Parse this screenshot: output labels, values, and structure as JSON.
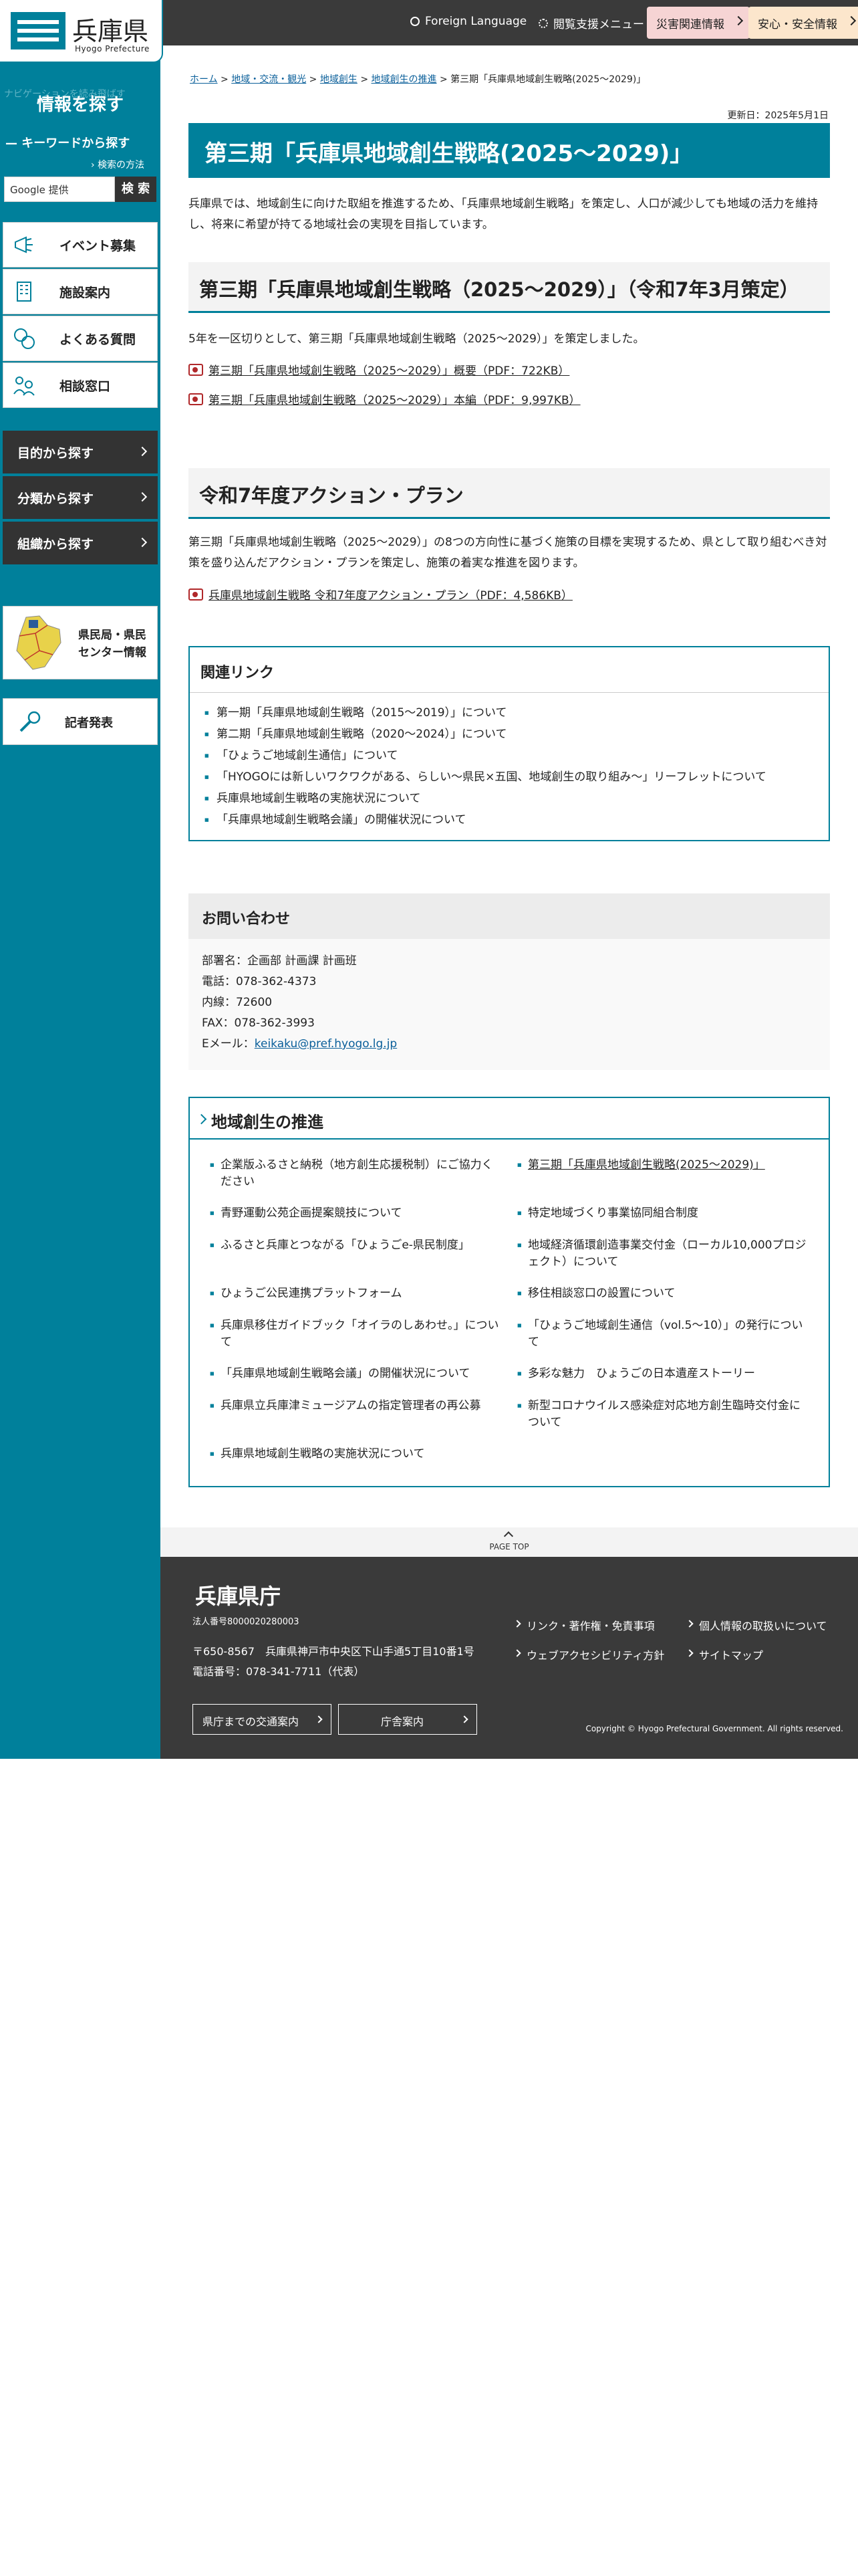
{
  "header": {
    "foreign_language": "Foreign Language",
    "accessibility": "閲覧支援メニュー",
    "disaster": "災害関連情報",
    "safety": "安心・安全情報"
  },
  "logo": {
    "name": "兵庫県",
    "sub": "Hyogo Prefecture"
  },
  "sidebar": {
    "faint_text": "ナビゲーションを読み飛ばす",
    "heading": "情報を探す",
    "keyword": "キーワードから探す",
    "how_to": "検索の方法",
    "search_placeholder": "Google 提供",
    "search_button": "検 索",
    "items": [
      "イベント募集",
      "施設案内",
      "よくある質問",
      "相談窓口"
    ],
    "dark_items": [
      "目的から探す",
      "分類から探す",
      "組織から探す"
    ],
    "center_label_1": "県民局・県民",
    "center_label_2": "センター情報",
    "press": "記者発表"
  },
  "breadcrumb": {
    "home": "ホーム",
    "c1": "地域・交流・観光",
    "c2": "地域創生",
    "c3": "地域創生の推進",
    "current": "第三期「兵庫県地域創生戦略(2025〜2029)」"
  },
  "updated": "更新日：2025年5月1日",
  "title": "第三期「兵庫県地域創生戦略(2025〜2029)」",
  "intro": "兵庫県では、地域創生に向けた取組を推進するため、「兵庫県地域創生戦略」を策定し、人口が減少しても地域の活力を維持し、将来に希望が持てる地域社会の実現を目指しています。",
  "section1": {
    "heading": "第三期「兵庫県地域創生戦略（2025〜2029）」（令和7年3月策定）",
    "text": "5年を一区切りとして、第三期「兵庫県地域創生戦略（2025〜2029）」を策定しました。",
    "pdf1": "第三期「兵庫県地域創生戦略（2025〜2029）」概要（PDF：722KB）",
    "pdf2": "第三期「兵庫県地域創生戦略（2025〜2029）」本編（PDF：9,997KB）"
  },
  "section2": {
    "heading": "令和7年度アクション・プラン",
    "text": "第三期「兵庫県地域創生戦略（2025〜2029）」の8つの方向性に基づく施策の目標を実現するため、県として取り組むべき対策を盛り込んだアクション・プランを策定し、施策の着実な推進を図ります。",
    "pdf": "兵庫県地域創生戦略 令和7年度アクション・プラン（PDF：4,586KB）"
  },
  "related": {
    "heading": "関連リンク",
    "items": [
      "第一期「兵庫県地域創生戦略（2015〜2019）」について",
      "第二期「兵庫県地域創生戦略（2020〜2024）」について",
      "「ひょうご地域創生通信」について",
      "「HYOGOには新しいワクワクがある、らしい〜県民×五国、地域創生の取り組み〜」リーフレットについて",
      "兵庫県地域創生戦略の実施状況について",
      "「兵庫県地域創生戦略会議」の開催状況について"
    ]
  },
  "contact": {
    "heading": "お問い合わせ",
    "dept": "部署名：企画部 計画課 計画班",
    "tel": "電話：078-362-4373",
    "ext": "内線：72600",
    "fax": "FAX：078-362-3993",
    "email_label": "Eメール：",
    "email": "keikaku@pref.hyogo.lg.jp"
  },
  "promo": {
    "heading": "地域創生の推進",
    "left": [
      "企業版ふるさと納税（地方創生応援税制）にご協力ください",
      "青野運動公苑企画提案競技について",
      "ふるさと兵庫とつながる「ひょうごe-県民制度」",
      "ひょうご公民連携プラットフォーム",
      "兵庫県移住ガイドブック「オイラのしあわせ。」について",
      "「兵庫県地域創生戦略会議」の開催状況について",
      "兵庫県立兵庫津ミュージアムの指定管理者の再公募",
      "兵庫県地域創生戦略の実施状況について"
    ],
    "right": [
      "第三期「兵庫県地域創生戦略(2025〜2029)」",
      "特定地域づくり事業協同組合制度",
      "地域経済循環創造事業交付金（ローカル10,000プロジェクト）について",
      "移住相談窓口の設置について",
      "「ひょうご地域創生通信（vol.5〜10）」の発行について",
      "多彩な魅力　ひょうごの日本遺産ストーリー",
      "新型コロナウイルス感染症対応地方創生臨時交付金について"
    ]
  },
  "pagetop": "PAGE TOP",
  "footer": {
    "name": "兵庫県庁",
    "corp": "法人番号8000020280003",
    "address": "〒650-8567　兵庫県神戸市中央区下山手通5丁目10番1号",
    "tel": "電話番号：078-341-7711（代表）",
    "btn1": "県庁までの交通案内",
    "btn2": "庁舎案内",
    "links": [
      "リンク・著作権・免責事項",
      "個人情報の取扱いについて",
      "ウェブアクセシビリティ方針",
      "サイトマップ"
    ],
    "copyright": "Copyright © Hyogo Prefectural Government. All rights reserved."
  },
  "colors": {
    "accent": "#00809b",
    "dark": "#3a3a3a",
    "disaster_bg": "#f6d4d4",
    "safety_bg": "#fce6cc"
  }
}
